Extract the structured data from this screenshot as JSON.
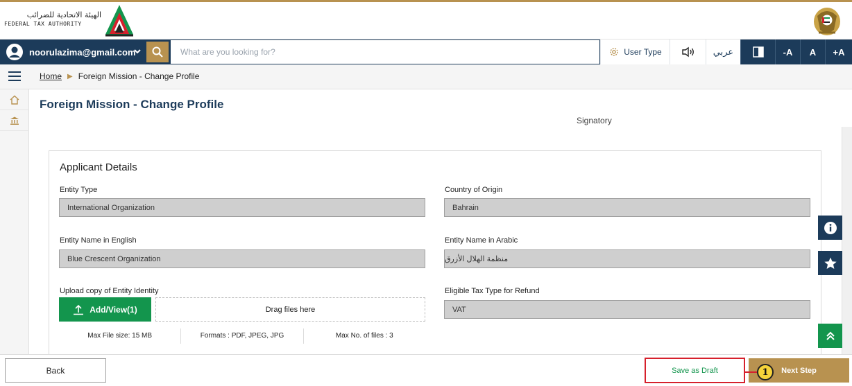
{
  "header": {
    "logo_arabic": "الهيئة الاتحادية للضرائب",
    "logo_english": "FEDERAL TAX AUTHORITY"
  },
  "nav": {
    "user_email": "noorulazima@gmail.com",
    "search_placeholder": "What are you looking for?",
    "user_type_label": "User Type",
    "language_label": "عربي",
    "font_decrease": "-A",
    "font_normal": "A",
    "font_increase": "+A"
  },
  "breadcrumb": {
    "home": "Home",
    "current": "Foreign Mission - Change Profile"
  },
  "page": {
    "title": "Foreign Mission - Change Profile",
    "partial_text": "Signatory"
  },
  "applicant": {
    "section_title": "Applicant Details",
    "entity_type_label": "Entity Type",
    "entity_type_value": "International Organization",
    "country_label": "Country of Origin",
    "country_value": "Bahrain",
    "name_en_label": "Entity Name in English",
    "name_en_value": "Blue Crescent Organization",
    "name_ar_label": "Entity Name in Arabic",
    "name_ar_value": "منظمة الهلال الأزرق",
    "upload_label": "Upload copy of Entity Identity",
    "add_view_label": "Add/View(1)",
    "drag_label": "Drag files here",
    "max_size": "Max File size: 15 MB",
    "formats": "Formats : PDF, JPEG, JPG",
    "max_files": "Max No. of files : 3",
    "tax_type_label": "Eligible Tax Type for Refund",
    "tax_type_value": "VAT"
  },
  "footer": {
    "back_label": "Back",
    "draft_label": "Save as Draft",
    "next_label": "Next Step",
    "step_number": "1"
  },
  "colors": {
    "navy": "#1c3b5a",
    "gold": "#b89250",
    "green": "#13954d",
    "highlight_red": "#d6202c"
  }
}
